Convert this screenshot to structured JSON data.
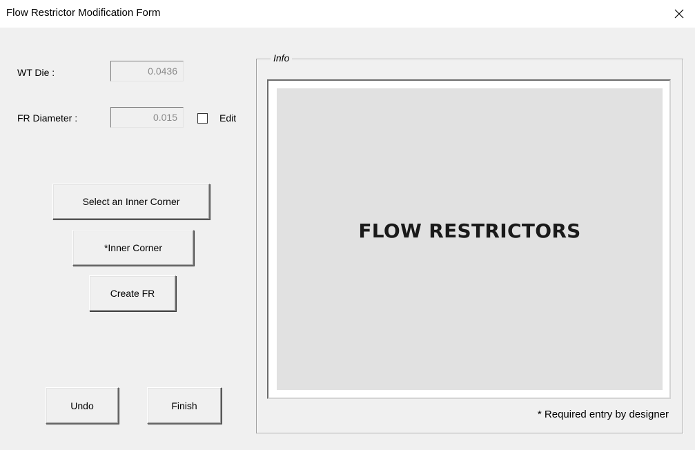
{
  "window": {
    "title": "Flow Restrictor Modification Form",
    "close_symbol": "✕"
  },
  "fields": {
    "wt_die": {
      "label": "WT Die :",
      "value": "0.0436"
    },
    "fr_diameter": {
      "label": "FR Diameter :",
      "value": "0.015"
    },
    "edit_checkbox": {
      "label": "Edit",
      "checked": false
    }
  },
  "buttons": {
    "select_inner_corner": "Select an Inner Corner",
    "inner_corner": "*Inner Corner",
    "create_fr": "Create FR",
    "undo": "Undo",
    "finish": "Finish"
  },
  "info": {
    "legend": "Info",
    "image_caption": "FLOW RESTRICTORS",
    "footnote": "* Required entry by designer"
  },
  "icons": {
    "close": "close-icon"
  },
  "colors": {
    "window_bg": "#f0f0f0",
    "titlebar_bg": "#ffffff",
    "image_bg": "#e1e1e1"
  }
}
